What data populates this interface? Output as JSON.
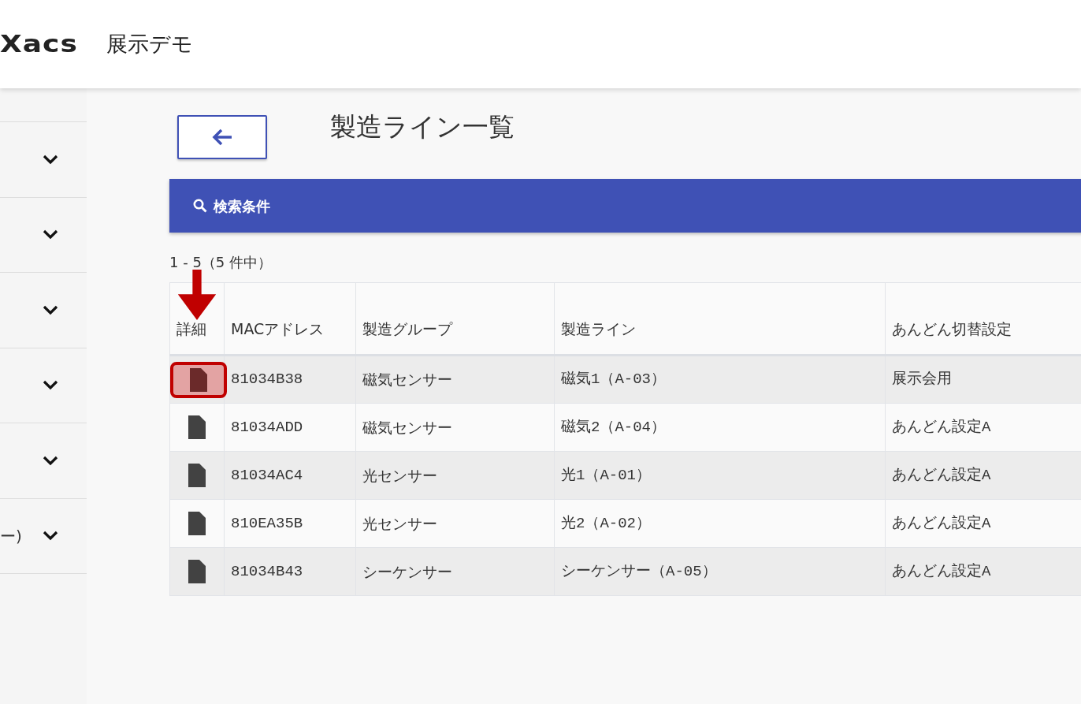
{
  "header": {
    "logo": "Xacs",
    "title": "展示デモ"
  },
  "sidebar": {
    "items": [
      {
        "expanded": false
      },
      {
        "expanded": false
      },
      {
        "expanded": false
      },
      {
        "expanded": false
      },
      {
        "expanded": false
      },
      {
        "label": "ー)",
        "expanded": false
      }
    ]
  },
  "page": {
    "title": "製造ライン一覧"
  },
  "search_panel": {
    "label": "検索条件"
  },
  "result_count": "1 - 5（5 件中）",
  "table": {
    "columns": [
      "詳細",
      "MACアドレス",
      "製造グループ",
      "製造ライン",
      "あんどん切替設定"
    ],
    "rows": [
      {
        "mac": "81034B38",
        "group": "磁気センサー",
        "line": "磁気1（A-03）",
        "setting": "展示会用",
        "highlighted": true
      },
      {
        "mac": "81034ADD",
        "group": "磁気センサー",
        "line": "磁気2（A-04）",
        "setting": "あんどん設定A",
        "highlighted": false
      },
      {
        "mac": "81034AC4",
        "group": "光センサー",
        "line": "光1（A-01）",
        "setting": "あんどん設定A",
        "highlighted": false
      },
      {
        "mac": "810EA35B",
        "group": "光センサー",
        "line": "光2（A-02）",
        "setting": "あんどん設定A",
        "highlighted": false
      },
      {
        "mac": "81034B43",
        "group": "シーケンサー",
        "line": "シーケンサー（A-05）",
        "setting": "あんどん設定A",
        "highlighted": false
      }
    ]
  }
}
